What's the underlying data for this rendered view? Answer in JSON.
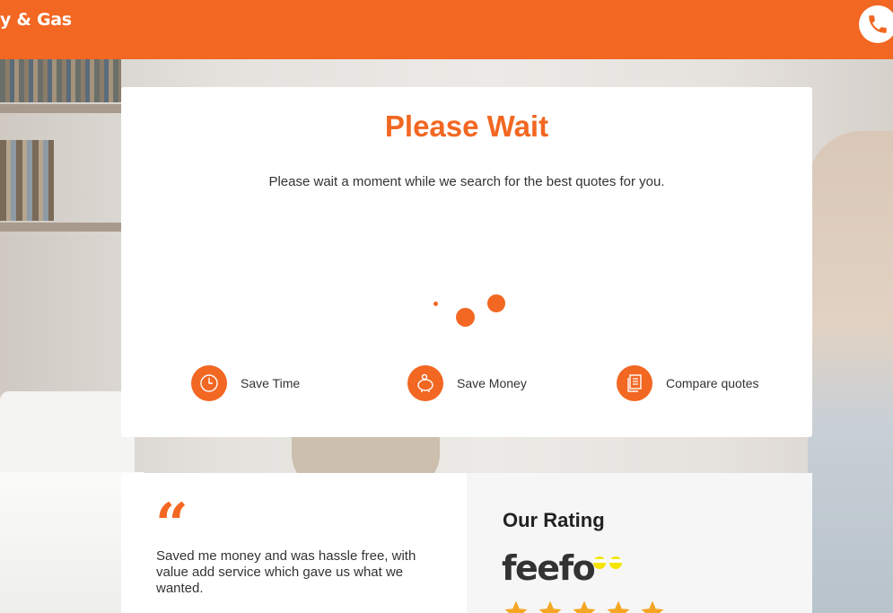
{
  "header": {
    "brand_text": "y & Gas",
    "phone_icon": "phone-icon"
  },
  "status_card": {
    "title": "Please Wait",
    "message": "Please wait a moment while we search for the best quotes for you.",
    "features": [
      {
        "label": "Save Time",
        "icon": "clock-icon"
      },
      {
        "label": "Save Money",
        "icon": "piggy-bank-icon"
      },
      {
        "label": "Compare quotes",
        "icon": "documents-icon"
      }
    ]
  },
  "testimonial": {
    "quote_mark": "“",
    "text": "Saved me money and was hassle free, with value add service which gave us what we wanted."
  },
  "rating": {
    "title": "Our Rating",
    "provider": "feefo",
    "stars": 5
  },
  "colors": {
    "accent": "#f26722",
    "star": "#f5a623"
  }
}
